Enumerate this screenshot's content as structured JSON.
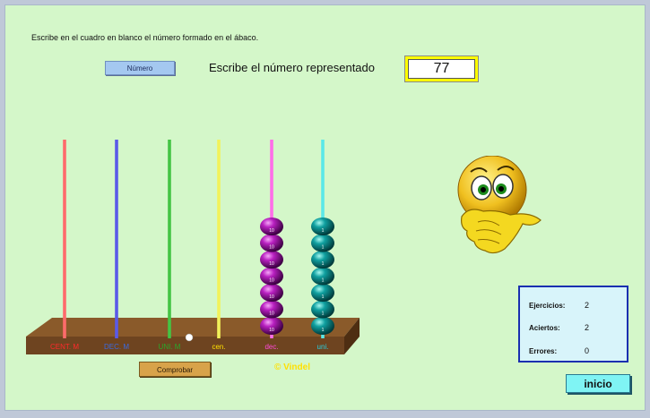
{
  "instruction": "Escribe en el cuadro en blanco el número formado en el ábaco.",
  "numero_button": "Número",
  "prompt_label": "Escribe el número representado",
  "answer_value": "77",
  "abacus": {
    "rods": [
      {
        "label": "CENT. M",
        "beads": 0,
        "bead_label": "",
        "rod_color": "#ff6b6b",
        "label_color": "#ff2a2a"
      },
      {
        "label": "DEC. M",
        "beads": 0,
        "bead_label": "",
        "rod_color": "#5a5ae8",
        "label_color": "#3a6ae0"
      },
      {
        "label": "UNI. M",
        "beads": 0,
        "bead_label": "",
        "rod_color": "#44c444",
        "label_color": "#2aa82a"
      },
      {
        "label": "cen.",
        "beads": 0,
        "bead_label": "",
        "rod_color": "#f2f25a",
        "label_color": "#ffe000"
      },
      {
        "label": "dec.",
        "beads": 7,
        "bead_label": "10",
        "rod_color": "#ff6ee8",
        "label_color": "#ff4ad8"
      },
      {
        "label": "uni.",
        "beads": 7,
        "bead_label": "1",
        "rod_color": "#5ae8e8",
        "label_color": "#28d0e0"
      }
    ]
  },
  "comprobar_button": "Comprobar",
  "credit": "©  Vindel",
  "stats": {
    "ejercicios_label": "Ejercicios:",
    "ejercicios_value": "2",
    "aciertos_label": "Aciertos:",
    "aciertos_value": "2",
    "errores_label": "Errores:",
    "errores_value": "0"
  },
  "inicio_button": "inicio",
  "colors": {
    "background": "#d4f7c9",
    "board": "#7a4a1c",
    "tens_bead": "#9b0fa0",
    "units_bead": "#0f8a8a"
  }
}
